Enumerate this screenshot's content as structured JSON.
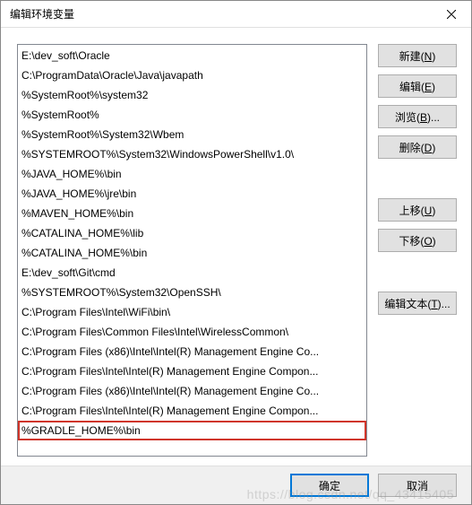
{
  "window": {
    "title": "编辑环境变量"
  },
  "list": {
    "items": [
      "E:\\dev_soft\\Oracle",
      "C:\\ProgramData\\Oracle\\Java\\javapath",
      "%SystemRoot%\\system32",
      "%SystemRoot%",
      "%SystemRoot%\\System32\\Wbem",
      "%SYSTEMROOT%\\System32\\WindowsPowerShell\\v1.0\\",
      "%JAVA_HOME%\\bin",
      "%JAVA_HOME%\\jre\\bin",
      "%MAVEN_HOME%\\bin",
      "%CATALINA_HOME%\\lib",
      "%CATALINA_HOME%\\bin",
      "E:\\dev_soft\\Git\\cmd",
      "%SYSTEMROOT%\\System32\\OpenSSH\\",
      "C:\\Program Files\\Intel\\WiFi\\bin\\",
      "C:\\Program Files\\Common Files\\Intel\\WirelessCommon\\",
      "C:\\Program Files (x86)\\Intel\\Intel(R) Management Engine Co...",
      "C:\\Program Files\\Intel\\Intel(R) Management Engine Compon...",
      "C:\\Program Files (x86)\\Intel\\Intel(R) Management Engine Co...",
      "C:\\Program Files\\Intel\\Intel(R) Management Engine Compon...",
      "%GRADLE_HOME%\\bin"
    ],
    "highlighted_index": 19
  },
  "buttons": {
    "new": {
      "label": "新建(",
      "key": "N",
      "suffix": ")"
    },
    "edit": {
      "label": "编辑(",
      "key": "E",
      "suffix": ")"
    },
    "browse": {
      "label": "浏览(",
      "key": "B",
      "suffix": ")..."
    },
    "delete": {
      "label": "删除(",
      "key": "D",
      "suffix": ")"
    },
    "move_up": {
      "label": "上移(",
      "key": "U",
      "suffix": ")"
    },
    "move_down": {
      "label": "下移(",
      "key": "O",
      "suffix": ")"
    },
    "edit_text": {
      "label": "编辑文本(",
      "key": "T",
      "suffix": ")..."
    }
  },
  "footer": {
    "ok": "确定",
    "cancel": "取消"
  },
  "watermark": "https://blog.csdn.net/qq_43415405"
}
